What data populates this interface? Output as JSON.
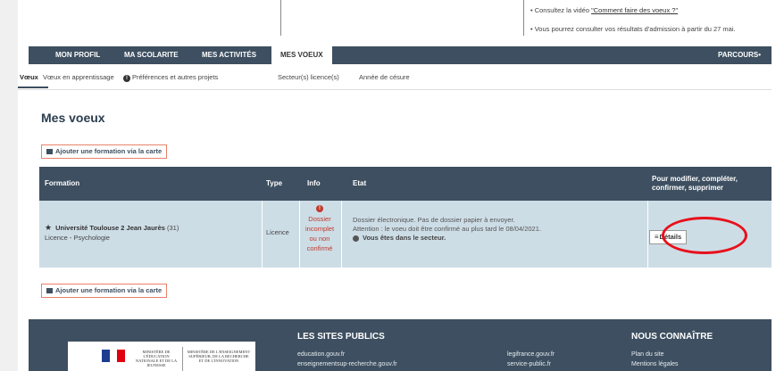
{
  "top_info": {
    "line1_prefix": "• Consultez la vidéo ",
    "line1_link": "\"Comment faire des voeux ?\"",
    "line2": "• Vous pourrez consulter vos résultats d'admission à partir du 27 mai."
  },
  "nav": {
    "items": [
      "MON PROFIL",
      "MA SCOLARITE",
      "MES ACTIVITÉS",
      "MES VOEUX"
    ],
    "right": "PARCOURS•"
  },
  "subtabs": [
    "Vœux",
    "Vœux en apprentissage",
    "Préférences et autres projets",
    "Secteur(s) licence(s)",
    "Année de césure"
  ],
  "page_title": "Mes voeux",
  "add_button": "Ajouter une formation via la carte",
  "table": {
    "headers": {
      "formation": "Formation",
      "type": "Type",
      "info": "Info",
      "etat": "Etat",
      "actions": "Pour modifier, compléter, confirmer, supprimer"
    },
    "row": {
      "university": "Université Toulouse 2 Jean Jaurès",
      "dept": "(31)",
      "program": "Licence - Psychologie",
      "type": "Licence",
      "info_status": [
        "Dossier",
        "incomplet",
        "ou non",
        "confirmé"
      ],
      "etat_line1": "Dossier électronique. Pas de dossier papier à envoyer.",
      "etat_line2": "Attention : le voeu doit être confirmé au plus tard le 08/04/2021.",
      "etat_line3": "Vous êtes dans le secteur.",
      "details": "Détails"
    }
  },
  "footer": {
    "sites_title": "LES SITES PUBLICS",
    "sites": [
      "education.gouv.fr",
      "enseignementsup-recherche.gouv.fr",
      "legifrance.gouv.fr",
      "service-public.fr"
    ],
    "know_title": "NOUS CONNAÎTRE",
    "know": [
      "Plan du site",
      "Mentions légales"
    ],
    "logo_left": "MINISTÈRE DE L'ÉDUCATION NATIONALE ET DE LA JEUNESSE",
    "logo_right": "MINISTÈRE DE L'ENSEIGNEMENT SUPÉRIEUR, DE LA RECHERCHE ET DE L'INNOVATION"
  },
  "colors": {
    "nav_bg": "#3d4f60",
    "row_bg": "#cddde6",
    "alert_red": "#c0392b",
    "highlight_circle": "#e8101a"
  }
}
